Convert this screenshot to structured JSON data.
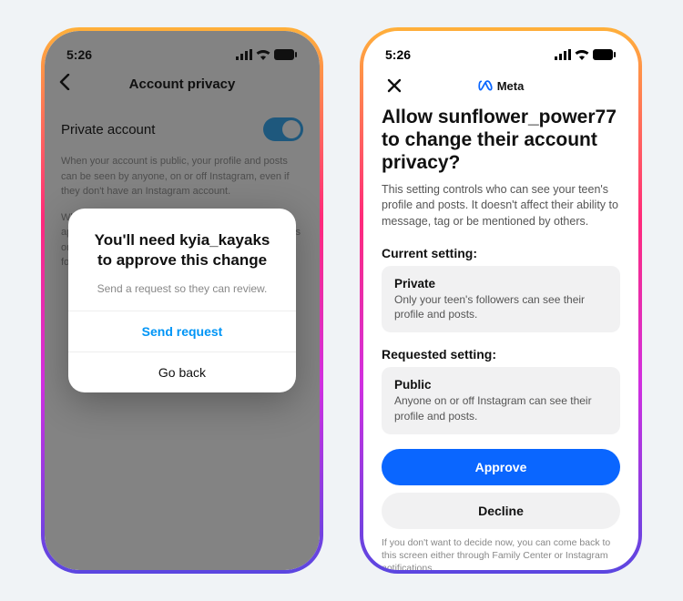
{
  "status": {
    "time": "5:26"
  },
  "phone1": {
    "header_title": "Account privacy",
    "setting_label": "Private account",
    "info1": "When your account is public, your profile and posts can be seen by anyone, on or off Instagram, even if they don't have an Instagram account.",
    "info2": "When your account is private, only the followers you approve can se what you share, including your photos or videos on hashtag and location pages, and your followers and fo",
    "dialog": {
      "title": "You'll need kyia_kayaks to approve this change",
      "subtitle": "Send a request so they can review.",
      "primary": "Send request",
      "secondary": "Go back"
    }
  },
  "phone2": {
    "brand": "Meta",
    "title": "Allow sunflower_power77 to change their account privacy?",
    "description": "This setting controls who can see your teen's profile and posts. It doesn't affect their ability to message, tag or be mentioned by others.",
    "current_label": "Current setting:",
    "current": {
      "title": "Private",
      "sub": "Only your teen's followers can see their profile and posts."
    },
    "requested_label": "Requested setting:",
    "requested": {
      "title": "Public",
      "sub": "Anyone on or off Instagram can see their profile and posts."
    },
    "approve": "Approve",
    "decline": "Decline",
    "footer": "If you don't want to decide now, you can come back to this screen either through Family Center or Instagram notifications."
  }
}
